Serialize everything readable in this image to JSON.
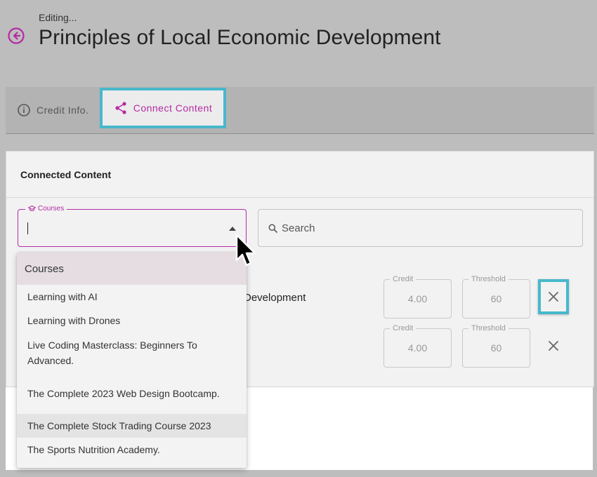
{
  "header": {
    "editing_label": "Editing...",
    "title": "Principles of Local Economic Development"
  },
  "tabs": [
    {
      "label": "Credit Info.",
      "icon": "info-circle-icon",
      "active": false
    },
    {
      "label": "Connect Content",
      "icon": "share-icon",
      "active": true
    }
  ],
  "panel": {
    "title": "Connected Content",
    "courses_field": {
      "label": "Courses",
      "value": ""
    },
    "search": {
      "placeholder": "Search"
    },
    "rows": [
      {
        "title": "Development",
        "credit_label": "Credit",
        "credit": "4.00",
        "threshold_label": "Threshold",
        "threshold": "60"
      },
      {
        "title": "",
        "credit_label": "Credit",
        "credit": "4.00",
        "threshold_label": "Threshold",
        "threshold": "60"
      }
    ]
  },
  "dropdown": {
    "header": "Courses",
    "items": [
      "Learning with AI",
      "Learning with Drones",
      "Live Coding Masterclass: Beginners To Advanced.",
      "The Complete 2023 Web Design Bootcamp.",
      "The Complete Stock Trading Course 2023",
      "The Sports Nutrition Academy."
    ]
  },
  "colors": {
    "accent": "#b52aa3",
    "highlight": "#48b8cc",
    "background": "#bdbdbd"
  }
}
